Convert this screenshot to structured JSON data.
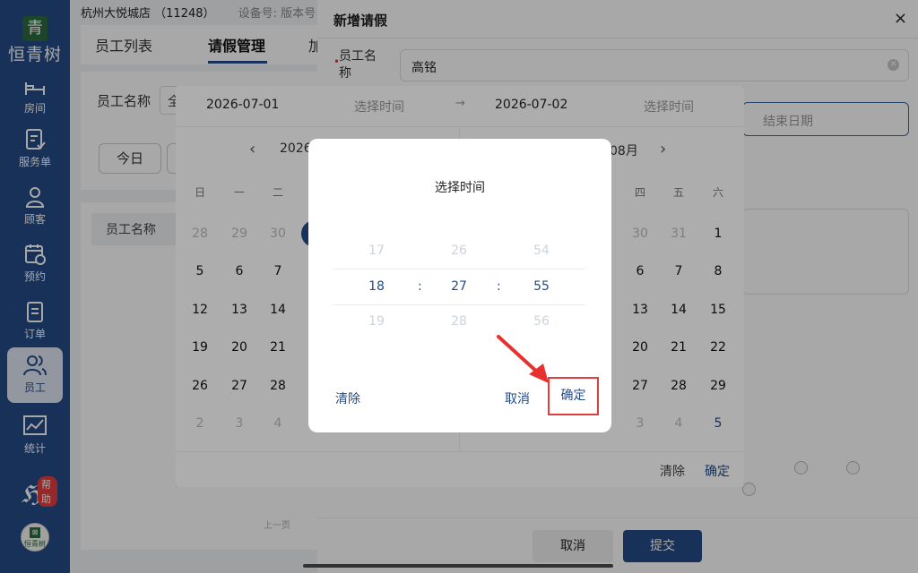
{
  "sidebar": {
    "logo_glyph": "青",
    "logo_text": "恒青树",
    "items": [
      {
        "label": "房间",
        "icon": "room-icon"
      },
      {
        "label": "服务单",
        "icon": "service-order-icon"
      },
      {
        "label": "顾客",
        "icon": "customer-icon"
      },
      {
        "label": "预约",
        "icon": "calendar-clock-icon"
      },
      {
        "label": "订单",
        "icon": "order-icon"
      },
      {
        "label": "员工",
        "icon": "staff-icon"
      },
      {
        "label": "统计",
        "icon": "stats-icon"
      }
    ],
    "active_item": "员工",
    "help_badge": "帮助",
    "avatar_text": "恒青树"
  },
  "store": {
    "name": "杭州大悦城店",
    "code": "（11248）",
    "device": "设备号: 版本号"
  },
  "tabs": [
    {
      "label": "员工列表"
    },
    {
      "label": "请假管理"
    },
    {
      "label": "加班"
    }
  ],
  "filters": {
    "employee_label": "员工名称",
    "employee_select": "全",
    "today_button": "今日"
  },
  "list": {
    "header_employee": "员工名称",
    "prev_page": "上一页"
  },
  "drawer": {
    "title": "新增请假",
    "close_glyph": "×",
    "employee_label": "员工名称",
    "employee_value": "高铭",
    "end_date_placeholder": "结束日期",
    "cancel_label": "取消",
    "submit_label": "提交"
  },
  "date_picker": {
    "start_date": "2026-07-01",
    "start_time": "选择时间",
    "arrow": "→",
    "end_date": "2026-07-02",
    "end_time": "选择时间",
    "left_month": "2026",
    "right_month": "08月",
    "weekdays_left": [
      "日",
      "一",
      "二"
    ],
    "weekdays_right": [
      "四",
      "五",
      "六"
    ],
    "left_rows": [
      [
        "28",
        "29",
        "30"
      ],
      [
        "5",
        "6",
        "7"
      ],
      [
        "12",
        "13",
        "14"
      ],
      [
        "19",
        "20",
        "21"
      ],
      [
        "26",
        "27",
        "28"
      ],
      [
        "2",
        "3",
        "4"
      ]
    ],
    "right_rows": [
      [
        "30",
        "31",
        "1"
      ],
      [
        "6",
        "7",
        "8"
      ],
      [
        "13",
        "14",
        "15"
      ],
      [
        "20",
        "21",
        "22"
      ],
      [
        "27",
        "28",
        "29"
      ],
      [
        "3",
        "4",
        "5"
      ]
    ],
    "clear_label": "清除",
    "ok_label": "确定"
  },
  "time_dialog": {
    "title": "选择时间",
    "hours": [
      "17",
      "18",
      "19"
    ],
    "minutes": [
      "26",
      "27",
      "28"
    ],
    "seconds": [
      "54",
      "55",
      "56"
    ],
    "separator": ":",
    "clear_label": "清除",
    "cancel_label": "取消",
    "confirm_label": "确定"
  },
  "colors": {
    "brand": "#244b86",
    "highlight_box": "#e23d3d",
    "arrow": "#e8312f"
  }
}
